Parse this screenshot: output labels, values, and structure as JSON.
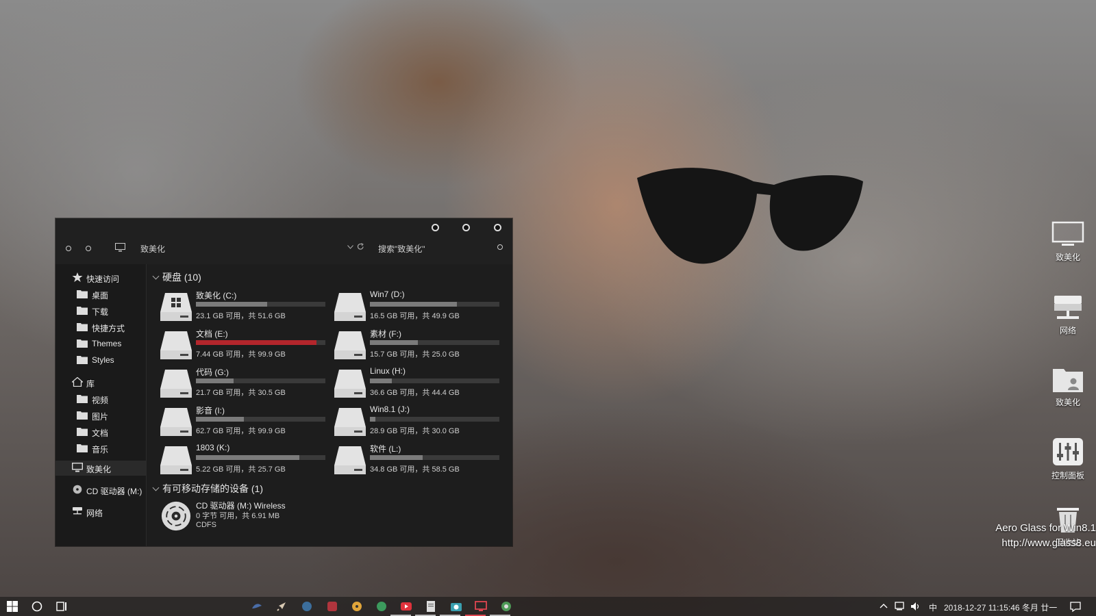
{
  "window": {
    "title": "致美化",
    "search_placeholder": "搜索\"致美化\""
  },
  "sidebar": {
    "items": [
      {
        "label": "快速访问",
        "icon": "star-icon"
      },
      {
        "label": "桌面",
        "icon": "folder-icon"
      },
      {
        "label": "下载",
        "icon": "folder-icon"
      },
      {
        "label": "快捷方式",
        "icon": "folder-icon"
      },
      {
        "label": "Themes",
        "icon": "folder-icon"
      },
      {
        "label": "Styles",
        "icon": "folder-icon"
      },
      {
        "label": "库",
        "icon": "home-icon"
      },
      {
        "label": "视频",
        "icon": "folder-icon"
      },
      {
        "label": "图片",
        "icon": "folder-icon"
      },
      {
        "label": "文档",
        "icon": "folder-icon"
      },
      {
        "label": "音乐",
        "icon": "folder-icon"
      },
      {
        "label": "致美化",
        "icon": "monitor-icon"
      },
      {
        "label": "CD 驱动器 (M:)",
        "icon": "cd-icon"
      },
      {
        "label": "网络",
        "icon": "network-icon"
      }
    ]
  },
  "groups": {
    "disks": "硬盘 (10)",
    "removable": "有可移动存储的设备 (1)"
  },
  "drives": [
    {
      "name": "致美化 (C:)",
      "info": "23.1 GB 可用，共 51.6 GB",
      "used": 0.55,
      "color": "#7b7b7b"
    },
    {
      "name": "Win7 (D:)",
      "info": "16.5 GB 可用，共 49.9 GB",
      "used": 0.67,
      "color": "#7b7b7b"
    },
    {
      "name": "文档 (E:)",
      "info": "7.44 GB 可用，共 99.9 GB",
      "used": 0.93,
      "color": "#b3262c"
    },
    {
      "name": "素材 (F:)",
      "info": "15.7 GB 可用，共 25.0 GB",
      "used": 0.37,
      "color": "#7b7b7b"
    },
    {
      "name": "代码 (G:)",
      "info": "21.7 GB 可用，共 30.5 GB",
      "used": 0.29,
      "color": "#7b7b7b"
    },
    {
      "name": "Linux (H:)",
      "info": "36.6 GB 可用，共 44.4 GB",
      "used": 0.17,
      "color": "#7b7b7b"
    },
    {
      "name": "影音 (I:)",
      "info": "62.7 GB 可用，共 99.9 GB",
      "used": 0.37,
      "color": "#7b7b7b"
    },
    {
      "name": "Win8.1 (J:)",
      "info": "28.9 GB 可用，共 30.0 GB",
      "used": 0.04,
      "color": "#7b7b7b"
    },
    {
      "name": "1803 (K:)",
      "info": "5.22 GB 可用，共 25.7 GB",
      "used": 0.8,
      "color": "#7b7b7b"
    },
    {
      "name": "软件 (L:)",
      "info": "34.8 GB 可用，共 58.5 GB",
      "used": 0.41,
      "color": "#7b7b7b"
    }
  ],
  "cd": {
    "name": "CD 驱动器 (M:) Wireless",
    "info": "0 字节 可用，共 6.91 MB",
    "fs": "CDFS"
  },
  "desktop": {
    "icons": [
      "致美化",
      "网络",
      "致美化",
      "控制面板",
      "回收站"
    ],
    "watermark_line1": "Aero Glass for Win8.1",
    "watermark_line2": "http://www.glass8.eu"
  },
  "taskbar": {
    "clock": "2018-12-27  11:15:46  冬月 廿一",
    "ime": "中"
  }
}
